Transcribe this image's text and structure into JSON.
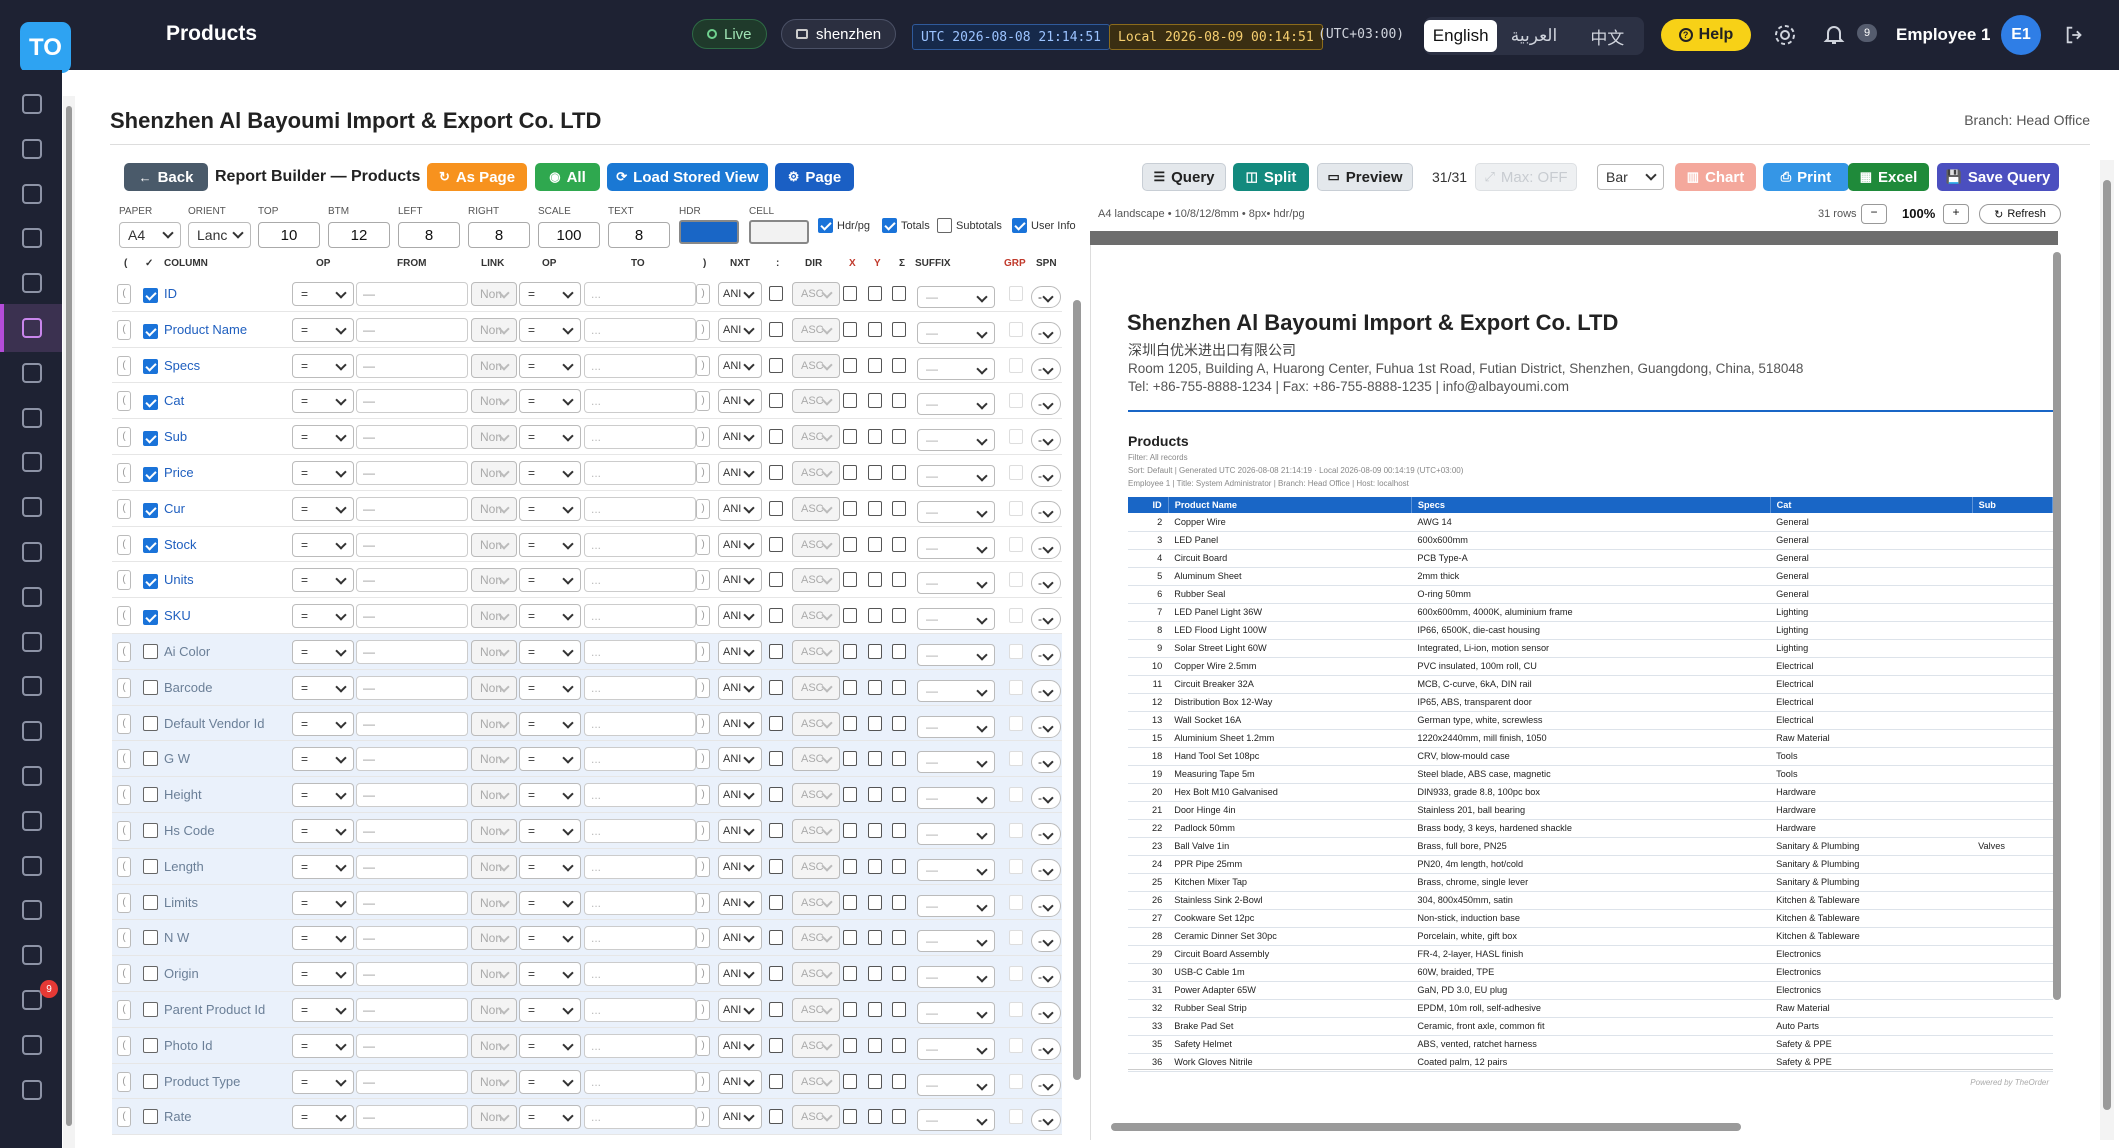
{
  "header": {
    "logo_text": "TO",
    "page_title": "Products",
    "live_label": "Live",
    "tenant_label": "shenzhen",
    "utc_clock": "UTC 2026-08-08 21:14:51",
    "local_clock": "Local 2026-08-09 00:14:51",
    "tz_offset": "(UTC+03:00)",
    "languages": [
      "English",
      "العربية",
      "中文"
    ],
    "help_label": "Help",
    "notif_count": "9",
    "user_name": "Employee 1",
    "avatar_initials": "E1"
  },
  "sidebar": {
    "badge_count": "9",
    "icons": [
      "dashboard-icon",
      "clipboard-icon",
      "cart-icon",
      "checklist-icon",
      "archive-icon",
      "box-icon",
      "layers-icon",
      "users-icon",
      "contact-icon",
      "accessibility-icon",
      "truck-icon",
      "invoice-icon",
      "wallet-icon",
      "bank-icon",
      "document-icon",
      "book-icon",
      "dollar-icon",
      "chart-icon",
      "chart-pie-icon",
      "inbox-icon",
      "megaphone-icon",
      "team-icon",
      "calendar-icon"
    ]
  },
  "page": {
    "company": "Shenzhen Al Bayoumi Import & Export Co. LTD",
    "branch": "Branch: Head Office"
  },
  "toolbar": {
    "back": "Back",
    "builder_title": "Report Builder — Products",
    "as_page": "As Page",
    "all": "All",
    "load_view": "Load Stored View",
    "page": "Page",
    "query": "Query",
    "split": "Split",
    "preview": "Preview",
    "page_count": "31/31",
    "max": "Max: OFF",
    "chart_type": "Bar",
    "chart": "Chart",
    "print": "Print",
    "excel": "Excel",
    "save_query": "Save Query"
  },
  "settings": {
    "labels": {
      "paper": "PAPER",
      "orient": "ORIENT",
      "top": "TOP",
      "btm": "BTM",
      "left": "LEFT",
      "right": "RIGHT",
      "scale": "SCALE",
      "text": "TEXT",
      "hdr": "HDR",
      "cell": "CELL"
    },
    "paper": "A4",
    "orient": "Lanc",
    "top": "10",
    "btm": "12",
    "left": "8",
    "right": "8",
    "scale": "100",
    "text": "8",
    "hdr_color": "#1966c6",
    "cell_color": "#f2f2f2",
    "hdr_pg_label": "Hdr/pg",
    "totals_label": "Totals",
    "subtotals_label": "Subtotals",
    "user_info_label": "User Info"
  },
  "columns_header": {
    "paren_open": "(",
    "check": "✓",
    "column": "COLUMN",
    "op": "OP",
    "from": "FROM",
    "link": "LINK",
    "op2": "OP",
    "to": "TO",
    "paren_close": ")",
    "nxt": "NXT",
    "colon": ":",
    "dir": "DIR",
    "x": "X",
    "y": "Y",
    "sigma": "Σ",
    "suffix": "SUFFIX",
    "grp": "GRP",
    "spn": "SPN"
  },
  "row_defaults": {
    "op": "=",
    "from_placeholder": "—",
    "link": "Non",
    "to_placeholder": "...",
    "nxt": "ANI",
    "dir": "ASC",
    "suffix": "—",
    "spn": "-"
  },
  "columns": [
    {
      "name": "ID",
      "checked": true
    },
    {
      "name": "Product Name",
      "checked": true
    },
    {
      "name": "Specs",
      "checked": true
    },
    {
      "name": "Cat",
      "checked": true
    },
    {
      "name": "Sub",
      "checked": true
    },
    {
      "name": "Price",
      "checked": true
    },
    {
      "name": "Cur",
      "checked": true
    },
    {
      "name": "Stock",
      "checked": true
    },
    {
      "name": "Units",
      "checked": true
    },
    {
      "name": "SKU",
      "checked": true
    },
    {
      "name": "Ai Color",
      "checked": false
    },
    {
      "name": "Barcode",
      "checked": false
    },
    {
      "name": "Default Vendor Id",
      "checked": false
    },
    {
      "name": "G W",
      "checked": false
    },
    {
      "name": "Height",
      "checked": false
    },
    {
      "name": "Hs Code",
      "checked": false
    },
    {
      "name": "Length",
      "checked": false
    },
    {
      "name": "Limits",
      "checked": false
    },
    {
      "name": "N W",
      "checked": false
    },
    {
      "name": "Origin",
      "checked": false
    },
    {
      "name": "Parent Product Id",
      "checked": false
    },
    {
      "name": "Photo Id",
      "checked": false
    },
    {
      "name": "Product Type",
      "checked": false
    },
    {
      "name": "Rate",
      "checked": false
    }
  ],
  "preview": {
    "meta": "A4 landscape • 10/8/12/8mm • 8px• hdr/pg",
    "rows_label": "31 rows",
    "zoom": "100%",
    "refresh": "Refresh",
    "company": "Shenzhen Al Bayoumi Import & Export Co. LTD",
    "company_cn": "深圳白优米进出口有限公司",
    "address": "Room 1205, Building A, Huarong Center, Fuhua 1st Road, Futian District, Shenzhen, Guangdong, China, 518048",
    "contact": "Tel: +86-755-8888-1234 | Fax: +86-755-8888-1235 | info@albayoumi.com",
    "report_title": "Products",
    "filter_line": "Filter: All records",
    "generated_line": "Sort: Default | Generated UTC 2026-08-08 21:14:19 · Local 2026-08-09 00:14:19 (UTC+03:00)",
    "employee_line": "Employee 1 | Title: System Administrator | Branch: Head Office | Host: localhost",
    "footer": "Powered by TheOrder",
    "headers": [
      "ID",
      "Product Name",
      "Specs",
      "Cat",
      "Sub"
    ],
    "rows": [
      [
        "2",
        "Copper Wire",
        "AWG 14",
        "General",
        ""
      ],
      [
        "3",
        "LED Panel",
        "600x600mm",
        "General",
        ""
      ],
      [
        "4",
        "Circuit Board",
        "PCB Type-A",
        "General",
        ""
      ],
      [
        "5",
        "Aluminum Sheet",
        "2mm thick",
        "General",
        ""
      ],
      [
        "6",
        "Rubber Seal",
        "O-ring 50mm",
        "General",
        ""
      ],
      [
        "7",
        "LED Panel Light 36W",
        "600x600mm, 4000K, aluminium frame",
        "Lighting",
        ""
      ],
      [
        "8",
        "LED Flood Light 100W",
        "IP66, 6500K, die-cast housing",
        "Lighting",
        ""
      ],
      [
        "9",
        "Solar Street Light 60W",
        "Integrated, Li-ion, motion sensor",
        "Lighting",
        ""
      ],
      [
        "10",
        "Copper Wire 2.5mm",
        "PVC insulated, 100m roll, CU",
        "Electrical",
        ""
      ],
      [
        "11",
        "Circuit Breaker 32A",
        "MCB, C-curve, 6kA, DIN rail",
        "Electrical",
        ""
      ],
      [
        "12",
        "Distribution Box 12-Way",
        "IP65, ABS, transparent door",
        "Electrical",
        ""
      ],
      [
        "13",
        "Wall Socket 16A",
        "German type, white, screwless",
        "Electrical",
        ""
      ],
      [
        "15",
        "Aluminium Sheet 1.2mm",
        "1220x2440mm, mill finish, 1050",
        "Raw Material",
        ""
      ],
      [
        "18",
        "Hand Tool Set 108pc",
        "CRV, blow-mould case",
        "Tools",
        ""
      ],
      [
        "19",
        "Measuring Tape 5m",
        "Steel blade, ABS case, magnetic",
        "Tools",
        ""
      ],
      [
        "20",
        "Hex Bolt M10 Galvanised",
        "DIN933, grade 8.8, 100pc box",
        "Hardware",
        ""
      ],
      [
        "21",
        "Door Hinge 4in",
        "Stainless 201, ball bearing",
        "Hardware",
        ""
      ],
      [
        "22",
        "Padlock 50mm",
        "Brass body, 3 keys, hardened shackle",
        "Hardware",
        ""
      ],
      [
        "23",
        "Ball Valve 1in",
        "Brass, full bore, PN25",
        "Sanitary & Plumbing",
        "Valves"
      ],
      [
        "24",
        "PPR Pipe 25mm",
        "PN20, 4m length, hot/cold",
        "Sanitary & Plumbing",
        ""
      ],
      [
        "25",
        "Kitchen Mixer Tap",
        "Brass, chrome, single lever",
        "Sanitary & Plumbing",
        ""
      ],
      [
        "26",
        "Stainless Sink 2-Bowl",
        "304, 800x450mm, satin",
        "Kitchen & Tableware",
        ""
      ],
      [
        "27",
        "Cookware Set 12pc",
        "Non-stick, induction base",
        "Kitchen & Tableware",
        ""
      ],
      [
        "28",
        "Ceramic Dinner Set 30pc",
        "Porcelain, white, gift box",
        "Kitchen & Tableware",
        ""
      ],
      [
        "29",
        "Circuit Board Assembly",
        "FR-4, 2-layer, HASL finish",
        "Electronics",
        ""
      ],
      [
        "30",
        "USB-C Cable 1m",
        "60W, braided, TPE",
        "Electronics",
        ""
      ],
      [
        "31",
        "Power Adapter 65W",
        "GaN, PD 3.0, EU plug",
        "Electronics",
        ""
      ],
      [
        "32",
        "Rubber Seal Strip",
        "EPDM, 10m roll, self-adhesive",
        "Raw Material",
        ""
      ],
      [
        "33",
        "Brake Pad Set",
        "Ceramic, front axle, common fit",
        "Auto Parts",
        ""
      ],
      [
        "35",
        "Safety Helmet",
        "ABS, vented, ratchet harness",
        "Safety & PPE",
        ""
      ],
      [
        "36",
        "Work Gloves Nitrile",
        "Coated palm, 12 pairs",
        "Safety & PPE",
        ""
      ]
    ]
  }
}
